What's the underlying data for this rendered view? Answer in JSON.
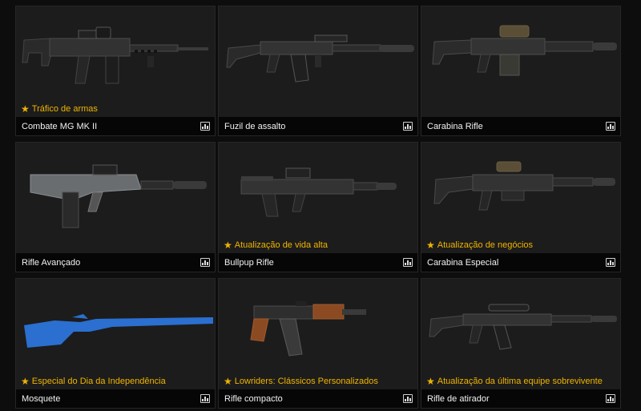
{
  "colors": {
    "page_bg": "#0d0d0d",
    "card_bg": "#1c1c1c",
    "badge": "#f0b400",
    "name_bar": "#060606",
    "musket_blue": "#2b6fd0"
  },
  "cards": [
    {
      "name": "Combate MG MK II",
      "badge": "Tráfico de armas",
      "icon": "combat-mg-mk2-image",
      "stats_icon": "stats-chart-icon"
    },
    {
      "name": "Fuzil de assalto",
      "badge": "",
      "icon": "assault-rifle-image",
      "stats_icon": "stats-chart-icon"
    },
    {
      "name": "Carabina Rifle",
      "badge": "",
      "icon": "carbine-rifle-image",
      "stats_icon": "stats-chart-icon"
    },
    {
      "name": "Rifle Avançado",
      "badge": "",
      "icon": "advanced-rifle-image",
      "stats_icon": "stats-chart-icon"
    },
    {
      "name": "Bullpup Rifle",
      "badge": "Atualização de vida alta",
      "icon": "bullpup-rifle-image",
      "stats_icon": "stats-chart-icon"
    },
    {
      "name": "Carabina Especial",
      "badge": "Atualização de negócios",
      "icon": "special-carbine-image",
      "stats_icon": "stats-chart-icon"
    },
    {
      "name": "Mosquete",
      "badge": "Especial do Dia da Independência",
      "icon": "musket-image",
      "stats_icon": "stats-chart-icon"
    },
    {
      "name": "Rifle compacto",
      "badge": "Lowriders: Clássicos Personalizados",
      "icon": "compact-rifle-image",
      "stats_icon": "stats-chart-icon"
    },
    {
      "name": "Rifle de atirador",
      "badge": "Atualização da última equipe sobrevivente",
      "icon": "marksman-rifle-image",
      "stats_icon": "stats-chart-icon"
    }
  ]
}
